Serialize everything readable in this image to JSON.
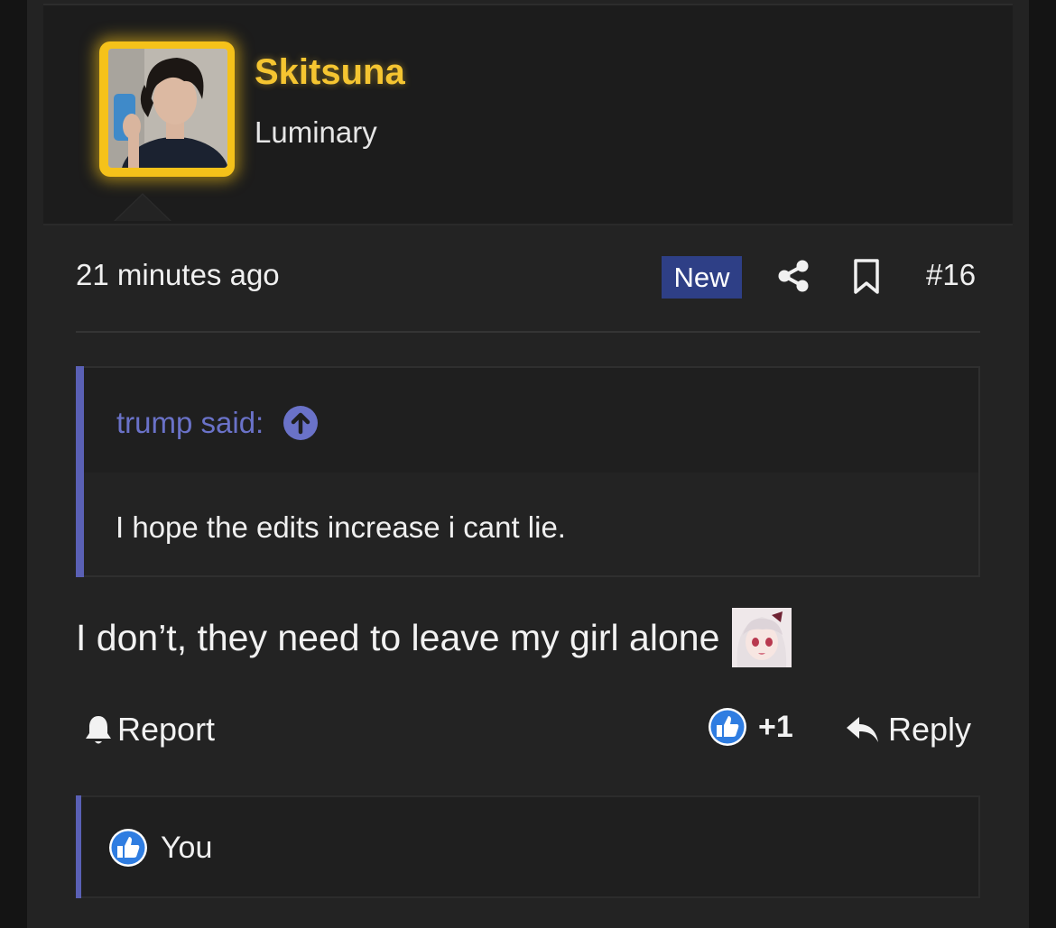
{
  "user": {
    "name": "Skitsuna",
    "title": "Luminary"
  },
  "post": {
    "time": "21 minutes ago",
    "badge": "New",
    "number": "#16",
    "message": "I don’t, they need to leave my girl alone"
  },
  "quote": {
    "author": "trump said:",
    "text": "I hope the edits increase i cant lie."
  },
  "actions": {
    "report": "Report",
    "like_count": "+1",
    "reply": "Reply"
  },
  "reactions": {
    "users": "You"
  },
  "colors": {
    "username": "#f5c531",
    "quote_accent": "#5a60b5",
    "badge_bg": "#2e3f86",
    "like_blue": "#2f7de1"
  }
}
